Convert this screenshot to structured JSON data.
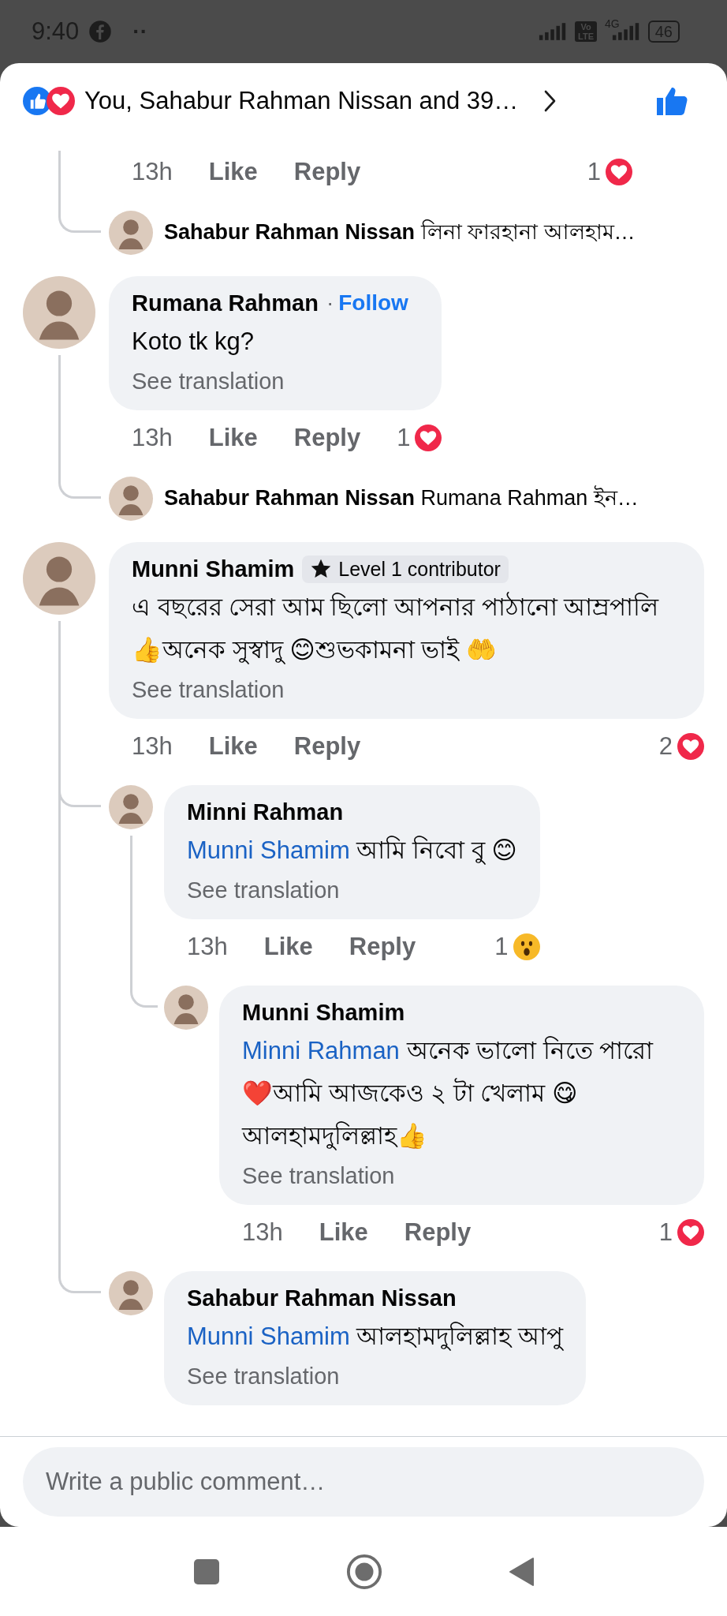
{
  "status_bar": {
    "time": "9:40",
    "dots": "··",
    "volte": [
      "Vo",
      "LTE"
    ],
    "network": "4G",
    "battery": "46"
  },
  "header": {
    "reactions": [
      {
        "kind": "like"
      },
      {
        "kind": "love"
      }
    ],
    "text": "You, Sahabur Rahman Nissan and 39…"
  },
  "comments": [
    {
      "kind": "partial",
      "actions": {
        "time": "13h",
        "like": "Like",
        "reply": "Reply",
        "reaction": {
          "kind": "love",
          "count": "1"
        }
      },
      "replies": [
        {
          "kind": "collapsed",
          "name": "Sahabur Rahman Nissan",
          "text": "লিনা ফারহানা আলহাম…"
        }
      ]
    },
    {
      "kind": "comment",
      "name": "Rumana Rahman",
      "follow": {
        "separator": "·",
        "label": "Follow"
      },
      "text": "Koto tk kg?",
      "translation": "See translation",
      "actions": {
        "time": "13h",
        "like": "Like",
        "reply": "Reply",
        "reaction": {
          "kind": "love",
          "count": "1"
        }
      },
      "replies": [
        {
          "kind": "collapsed",
          "name": "Sahabur Rahman Nissan",
          "text": "Rumana Rahman ইন…"
        }
      ]
    },
    {
      "kind": "comment",
      "name": "Munni Shamim",
      "badge": "Level 1 contributor",
      "text": "এ বছরের সেরা আম ছিলো আপনার পাঠানো আম্রপালি 👍অনেক সুস্বাদু 😊শুভকামনা ভাই 🤲",
      "translation": "See translation",
      "actions": {
        "time": "13h",
        "like": "Like",
        "reply": "Reply",
        "reaction": {
          "kind": "love",
          "count": "2"
        }
      },
      "replies": [
        {
          "kind": "comment",
          "name": "Minni Rahman",
          "mention": "Munni Shamim",
          "text": "আমি নিবো বু 😊",
          "translation": "See translation",
          "actions": {
            "time": "13h",
            "like": "Like",
            "reply": "Reply",
            "reaction": {
              "kind": "wow",
              "count": "1"
            }
          },
          "replies": [
            {
              "kind": "comment",
              "name": "Munni Shamim",
              "mention": "Minni Rahman",
              "text": "অনেক ভালো নিতে পারো ❤️আমি আজকেও ২ টা খেলাম 😋আলহামদুলিল্লাহ👍",
              "translation": "See translation",
              "actions": {
                "time": "13h",
                "like": "Like",
                "reply": "Reply",
                "reaction": {
                  "kind": "love",
                  "count": "1"
                }
              }
            }
          ]
        },
        {
          "kind": "comment",
          "name": "Sahabur Rahman Nissan",
          "mention": "Munni Shamim",
          "text": "আলহামদুলিল্লাহ আপু",
          "translation": "See translation"
        }
      ]
    }
  ],
  "composer": {
    "placeholder": "Write a public comment…"
  }
}
